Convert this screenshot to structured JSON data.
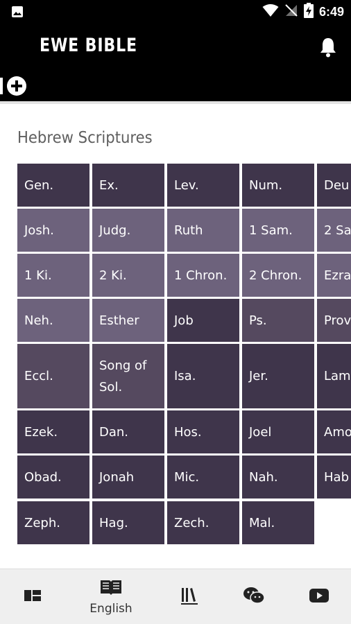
{
  "status_bar": {
    "time": "6:49",
    "icons": [
      "image-icon",
      "wifi-icon",
      "no-signal-icon",
      "battery-charging-icon"
    ]
  },
  "app": {
    "title": "EWE BIBLE",
    "icons": [
      "bell-icon",
      "add-icon"
    ]
  },
  "section": {
    "title": "Hebrew Scriptures"
  },
  "books": [
    {
      "label": "Gen.",
      "color": "#3f354b"
    },
    {
      "label": "Ex.",
      "color": "#3f354b"
    },
    {
      "label": "Lev.",
      "color": "#3f354b"
    },
    {
      "label": "Num.",
      "color": "#3f354b"
    },
    {
      "label": "Deu",
      "color": "#3f354b"
    },
    {
      "label": "Josh.",
      "color": "#6d627c"
    },
    {
      "label": "Judg.",
      "color": "#6d627c"
    },
    {
      "label": "Ruth",
      "color": "#6d627c"
    },
    {
      "label": "1 Sam.",
      "color": "#6d627c"
    },
    {
      "label": "2 Sa",
      "color": "#6d627c"
    },
    {
      "label": "1 Ki.",
      "color": "#6d627c"
    },
    {
      "label": "2 Ki.",
      "color": "#6d627c"
    },
    {
      "label": "1 Chron.",
      "color": "#6d627c"
    },
    {
      "label": "2 Chron.",
      "color": "#6d627c"
    },
    {
      "label": "Ezra",
      "color": "#6d627c"
    },
    {
      "label": "Neh.",
      "color": "#6d627c"
    },
    {
      "label": "Esther",
      "color": "#6d627c"
    },
    {
      "label": "Job",
      "color": "#3f354b"
    },
    {
      "label": "Ps.",
      "color": "#55495f"
    },
    {
      "label": "Prov",
      "color": "#55495f"
    },
    {
      "label": "Eccl.",
      "color": "#55495f"
    },
    {
      "label": "Song of Sol.",
      "color": "#55495f"
    },
    {
      "label": "Isa.",
      "color": "#3f354b"
    },
    {
      "label": "Jer.",
      "color": "#3f354b"
    },
    {
      "label": "Lam",
      "color": "#3f354b"
    },
    {
      "label": "Ezek.",
      "color": "#3f354b"
    },
    {
      "label": "Dan.",
      "color": "#3f354b"
    },
    {
      "label": "Hos.",
      "color": "#3f354b"
    },
    {
      "label": "Joel",
      "color": "#3f354b"
    },
    {
      "label": "Amo",
      "color": "#3f354b"
    },
    {
      "label": "Obad.",
      "color": "#3f354b"
    },
    {
      "label": "Jonah",
      "color": "#3f354b"
    },
    {
      "label": "Mic.",
      "color": "#3f354b"
    },
    {
      "label": "Nah.",
      "color": "#3f354b"
    },
    {
      "label": "Hab",
      "color": "#3f354b"
    },
    {
      "label": "Zeph.",
      "color": "#3f354b"
    },
    {
      "label": "Hag.",
      "color": "#3f354b"
    },
    {
      "label": "Zech.",
      "color": "#3f354b"
    },
    {
      "label": "Mal.",
      "color": "#3f354b"
    }
  ],
  "bottom_nav": {
    "items": [
      {
        "icon": "dashboard-icon",
        "label": ""
      },
      {
        "icon": "book-icon",
        "label": "English"
      },
      {
        "icon": "library-icon",
        "label": ""
      },
      {
        "icon": "wechat-icon",
        "label": ""
      },
      {
        "icon": "youtube-icon",
        "label": ""
      }
    ]
  }
}
